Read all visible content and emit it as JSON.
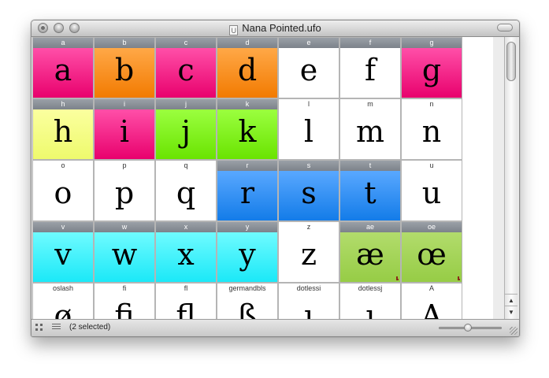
{
  "window": {
    "title": "Nana Pointed.ufo",
    "doc_icon": "U"
  },
  "colors": {
    "pink": "#f01e85",
    "orange": "#f9861d",
    "yellow": "#f4fd84",
    "green": "#7af10c",
    "blue": "#2286f1",
    "cyan": "#2ef0fb",
    "olive": "#a2d454",
    "white": "#ffffff"
  },
  "glyphs": [
    {
      "name": "a",
      "char": "a",
      "color": "pink",
      "selected": true
    },
    {
      "name": "b",
      "char": "b",
      "color": "orange",
      "selected": true
    },
    {
      "name": "c",
      "char": "c",
      "color": "pink",
      "selected": true
    },
    {
      "name": "d",
      "char": "d",
      "color": "orange",
      "selected": true
    },
    {
      "name": "e",
      "char": "e",
      "color": "white",
      "selected": true
    },
    {
      "name": "f",
      "char": "f",
      "color": "white",
      "selected": true
    },
    {
      "name": "g",
      "char": "g",
      "color": "pink",
      "selected": true
    },
    {
      "name": "h",
      "char": "h",
      "color": "yellow",
      "selected": true
    },
    {
      "name": "i",
      "char": "i",
      "color": "pink",
      "selected": true
    },
    {
      "name": "j",
      "char": "j",
      "color": "green",
      "selected": true
    },
    {
      "name": "k",
      "char": "k",
      "color": "green",
      "selected": true
    },
    {
      "name": "l",
      "char": "l",
      "color": "white",
      "selected": false
    },
    {
      "name": "m",
      "char": "m",
      "color": "white",
      "selected": false
    },
    {
      "name": "n",
      "char": "n",
      "color": "white",
      "selected": false
    },
    {
      "name": "o",
      "char": "o",
      "color": "white",
      "selected": false
    },
    {
      "name": "p",
      "char": "p",
      "color": "white",
      "selected": false
    },
    {
      "name": "q",
      "char": "q",
      "color": "white",
      "selected": false
    },
    {
      "name": "r",
      "char": "r",
      "color": "blue",
      "selected": true
    },
    {
      "name": "s",
      "char": "s",
      "color": "blue",
      "selected": true
    },
    {
      "name": "t",
      "char": "t",
      "color": "blue",
      "selected": true
    },
    {
      "name": "u",
      "char": "u",
      "color": "white",
      "selected": false
    },
    {
      "name": "v",
      "char": "v",
      "color": "cyan",
      "selected": true
    },
    {
      "name": "w",
      "char": "w",
      "color": "cyan",
      "selected": true
    },
    {
      "name": "x",
      "char": "x",
      "color": "cyan",
      "selected": true
    },
    {
      "name": "y",
      "char": "y",
      "color": "cyan",
      "selected": true
    },
    {
      "name": "z",
      "char": "z",
      "color": "white",
      "selected": false
    },
    {
      "name": "ae",
      "char": "æ",
      "color": "olive",
      "selected": true,
      "marked": true
    },
    {
      "name": "oe",
      "char": "œ",
      "color": "olive",
      "selected": true,
      "marked": true
    },
    {
      "name": "oslash",
      "char": "ø",
      "color": "white",
      "selected": false
    },
    {
      "name": "fi",
      "char": "fi",
      "color": "white",
      "selected": false
    },
    {
      "name": "fl",
      "char": "fl",
      "color": "white",
      "selected": false
    },
    {
      "name": "germandbls",
      "char": "ß",
      "color": "white",
      "selected": false
    },
    {
      "name": "dotlessi",
      "char": "ı",
      "color": "white",
      "selected": false
    },
    {
      "name": "dotlessj",
      "char": "ȷ",
      "color": "white",
      "selected": false
    },
    {
      "name": "A",
      "char": "A",
      "color": "white",
      "selected": false
    }
  ],
  "scrollbar": {
    "up_arrow": "▲",
    "down_arrow": "▼"
  },
  "status": {
    "selected_text": "(2 selected)",
    "zoom_level": 0.45
  }
}
